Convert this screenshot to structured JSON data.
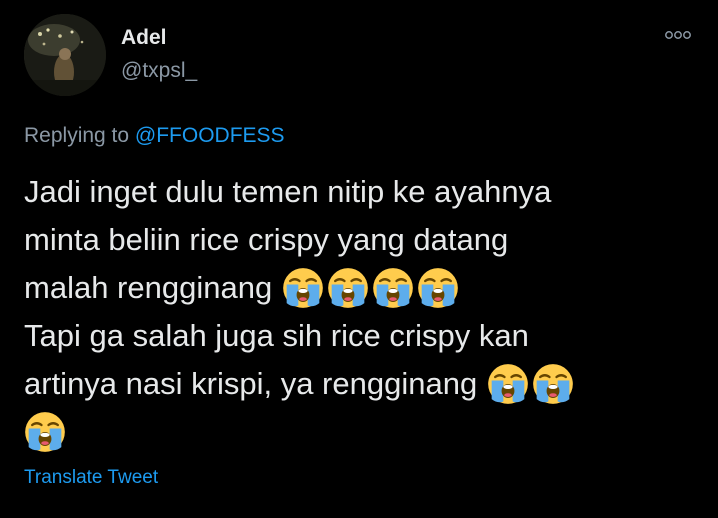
{
  "author": {
    "display_name": "Adel",
    "handle": "@txpsl_"
  },
  "more_icon": "more-horizontal-icon",
  "reply": {
    "prefix": "Replying to",
    "mention": "@FFOODFESS"
  },
  "tweet": {
    "lines": [
      "Jadi inget dulu temen nitip ke ayahnya",
      "minta beliin rice crispy yang datang",
      "malah rengginang",
      "Tapi ga salah juga sih rice crispy kan",
      "artinya nasi krispi, ya rengginang",
      ""
    ],
    "emoji_icon": "loudly-crying-face-emoji"
  },
  "translate_label": "Translate Tweet",
  "colors": {
    "background": "#000000",
    "text": "#e7e9ea",
    "secondary": "#8b98a5",
    "accent": "#1d9bf0",
    "emoji_face": "#ffcc4d",
    "emoji_tears": "#5dadec"
  }
}
